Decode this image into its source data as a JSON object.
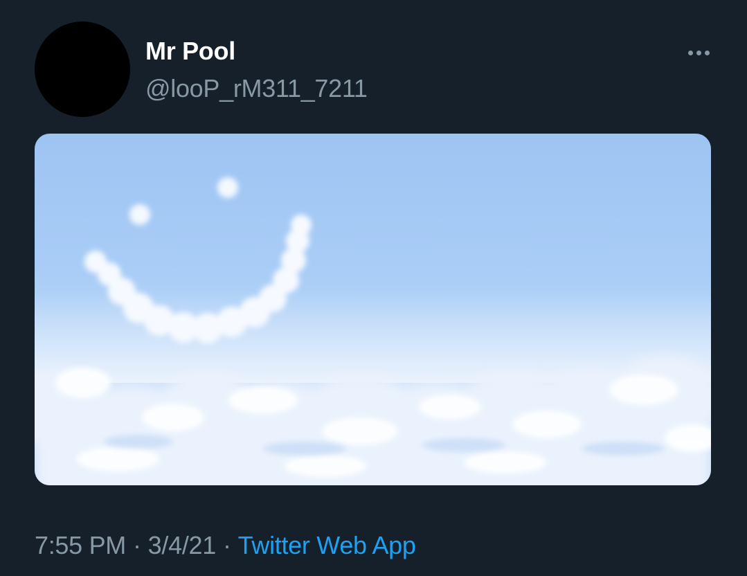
{
  "tweet": {
    "display_name": "Mr Pool",
    "handle": "@looP_rM311_7211",
    "time": "7:55 PM",
    "separator": "·",
    "date": "3/4/21",
    "source": "Twitter Web App",
    "media": {
      "icon": "cloud-smiley-image"
    },
    "more_icon": "more-options-icon"
  },
  "colors": {
    "background": "#15202b",
    "name_text": "#ffffff",
    "secondary_text": "#8899a6",
    "link": "#1da1f2"
  }
}
